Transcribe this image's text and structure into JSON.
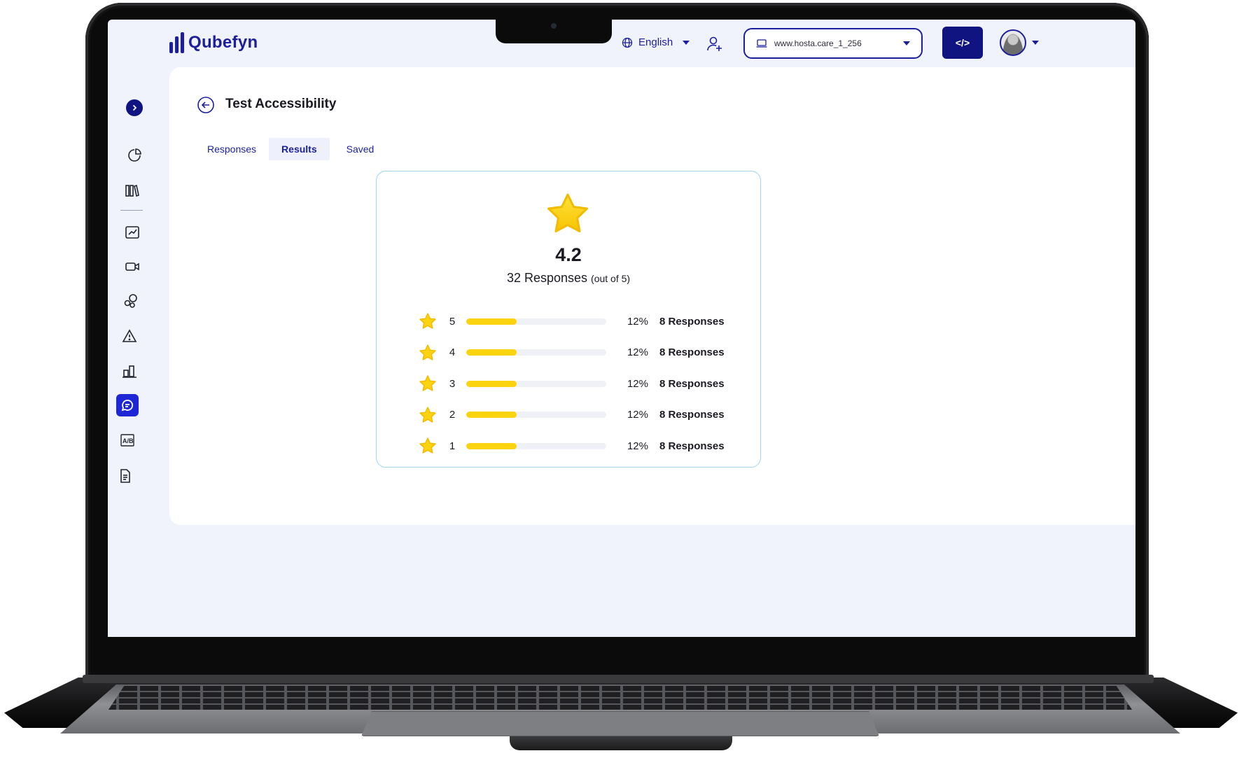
{
  "app": {
    "brand": "Qubefyn"
  },
  "header": {
    "language": "English",
    "url_select": "www.hosta.care_1_256",
    "code_button": "</>"
  },
  "page": {
    "title": "Test Accessibility",
    "tabs": [
      {
        "label": "Responses",
        "active": false
      },
      {
        "label": "Results",
        "active": true
      },
      {
        "label": "Saved",
        "active": false
      }
    ]
  },
  "rating": {
    "average": "4.2",
    "responses_label": "32 Responses",
    "scale_note": "(out of 5)",
    "rows": [
      {
        "level": "5",
        "percent": "12%",
        "fill": 0.36,
        "count": "8 Responses"
      },
      {
        "level": "4",
        "percent": "12%",
        "fill": 0.36,
        "count": "8 Responses"
      },
      {
        "level": "3",
        "percent": "12%",
        "fill": 0.36,
        "count": "8 Responses"
      },
      {
        "level": "2",
        "percent": "12%",
        "fill": 0.36,
        "count": "8 Responses"
      },
      {
        "level": "1",
        "percent": "12%",
        "fill": 0.36,
        "count": "8 Responses"
      }
    ]
  },
  "colors": {
    "brand": "#1b1f9e",
    "accent_active": "#1f26d6",
    "star": "#fbd30f",
    "card_border": "#9fd4ec"
  },
  "icons": {
    "sidebar": [
      "expand-icon",
      "pie-chart-icon",
      "library-icon",
      "trend-chart-icon",
      "video-icon",
      "bubbles-icon",
      "warning-icon",
      "bar-chart-icon",
      "chat-icon",
      "ab-test-icon",
      "document-icon"
    ]
  }
}
